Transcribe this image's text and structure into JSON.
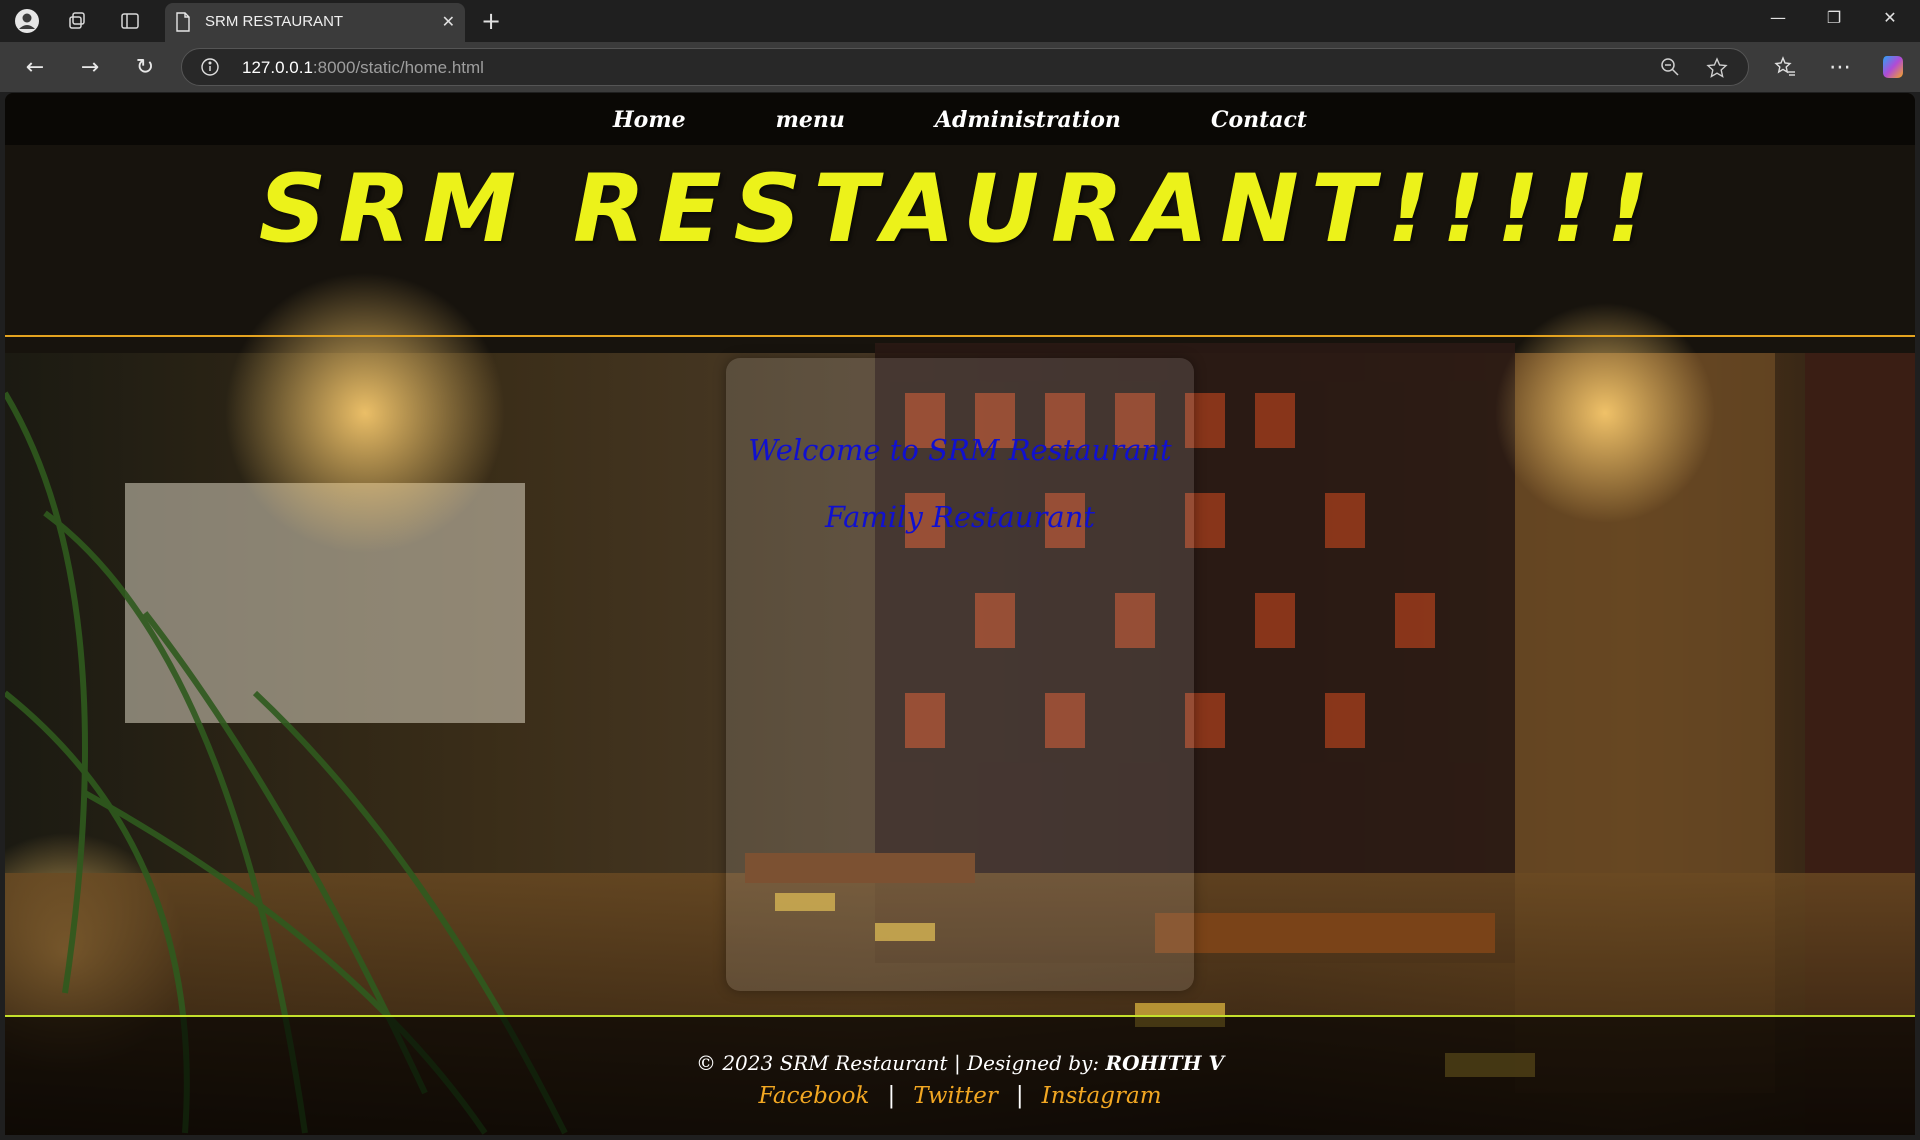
{
  "browser": {
    "tab_title": "SRM RESTAURANT",
    "url_host": "127.0.0.1",
    "url_rest": ":8000/static/home.html"
  },
  "nav": {
    "items": [
      {
        "label": "Home"
      },
      {
        "label": "menu"
      },
      {
        "label": "Administration"
      },
      {
        "label": "Contact"
      }
    ]
  },
  "hero": {
    "heading": "SRM RESTAURANT!!!!!",
    "welcome": "Welcome to SRM Restaurant",
    "subtitle": "Family Restaurant"
  },
  "footer": {
    "copyright_prefix": "© 2023 SRM Restaurant | Designed by:",
    "designer": "ROHITH V",
    "links": [
      {
        "label": "Facebook"
      },
      {
        "label": "Twitter"
      },
      {
        "label": "Instagram"
      }
    ],
    "separator": "|"
  },
  "colors": {
    "heading": "#ecf21a",
    "welcome_text": "#1010d0",
    "footer_link": "#f2a722",
    "top_rule": "#e4a320",
    "bottom_rule": "#c4e02c"
  }
}
